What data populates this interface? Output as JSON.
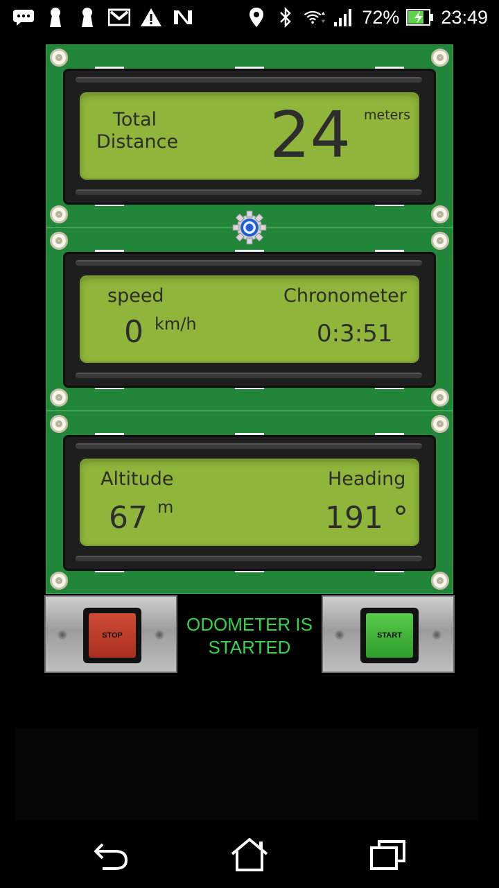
{
  "status_bar": {
    "battery_percent": "72%",
    "time": "23:49",
    "icons_left": [
      "message-icon",
      "keyhole-icon",
      "keyhole-icon",
      "gmail-icon",
      "warning-icon",
      "n-app-icon"
    ],
    "icons_right": [
      "location-icon",
      "bluetooth-icon",
      "wifi-icon",
      "signal-icon",
      "battery-charging-icon"
    ]
  },
  "display_distance": {
    "label_line1": "Total",
    "label_line2": "Distance",
    "value": "24",
    "unit": "meters"
  },
  "display_speed": {
    "speed_label": "speed",
    "speed_value": "0",
    "speed_unit": "km/h",
    "chrono_label": "Chronometer",
    "chrono_value": "0:3:51"
  },
  "display_position": {
    "altitude_label": "Altitude",
    "altitude_value": "67",
    "altitude_unit": "m",
    "heading_label": "Heading",
    "heading_value": "191 °"
  },
  "controls": {
    "stop_label": "STOP",
    "start_label": "START",
    "status_line1": "ODOMETER IS",
    "status_line2": "STARTED"
  },
  "colors": {
    "board": "#22863a",
    "lcd": "#8fb53a",
    "lcd_text": "#2d2d2d",
    "status_text": "#34d44a",
    "stop_button": "#c0392b",
    "start_button": "#3fb53a"
  },
  "navigation": [
    "back-icon",
    "home-icon",
    "recent-apps-icon"
  ]
}
